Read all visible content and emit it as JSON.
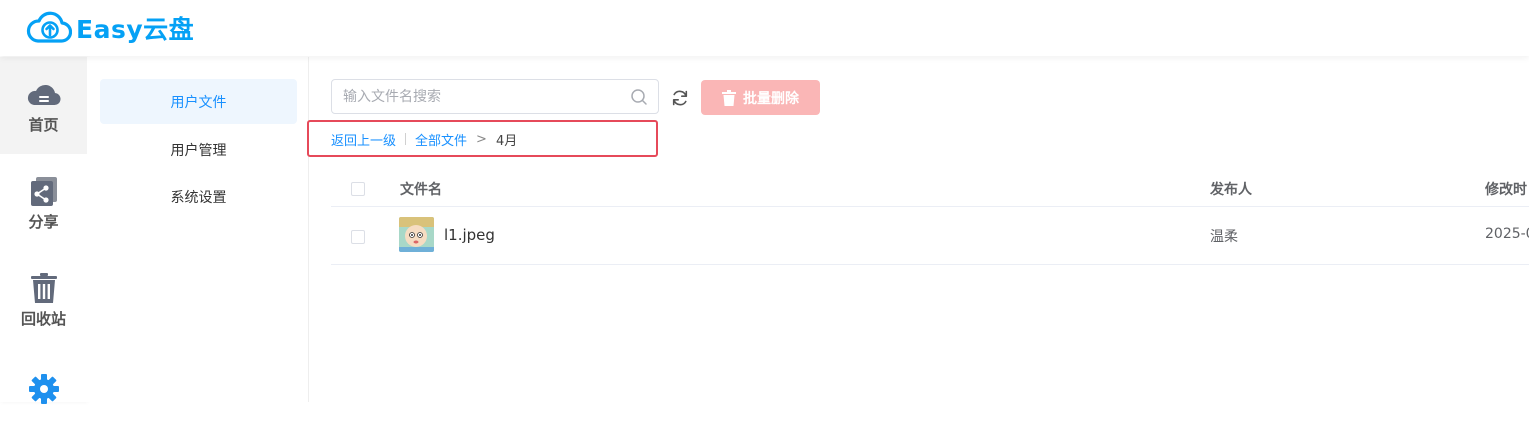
{
  "app": {
    "title": "Easy云盘",
    "brand_color": "#05a1f5"
  },
  "nav": {
    "items": [
      {
        "label": "首页",
        "icon": "cloud-icon",
        "active": true
      },
      {
        "label": "分享",
        "icon": "share-icon",
        "active": false
      },
      {
        "label": "回收站",
        "icon": "trash-icon",
        "active": false
      },
      {
        "label": "",
        "icon": "gear-icon",
        "active": false
      }
    ]
  },
  "subnav": {
    "items": [
      {
        "label": "用户文件",
        "active": true
      },
      {
        "label": "用户管理",
        "active": false
      },
      {
        "label": "系统设置",
        "active": false
      }
    ]
  },
  "toolbar": {
    "search_placeholder": "输入文件名搜索",
    "search_value": "",
    "batch_delete_label": "批量删除",
    "batch_delete_color": "#fab6b6"
  },
  "breadcrumb": {
    "back_label": "返回上一级",
    "root_label": "全部文件",
    "current_label": "4月",
    "highlight_color": "#e64a5a"
  },
  "table": {
    "columns": [
      "文件名",
      "发布人",
      "修改时"
    ],
    "rows": [
      {
        "filename": "l1.jpeg",
        "publisher": "温柔",
        "modified": "2025-0"
      }
    ]
  }
}
